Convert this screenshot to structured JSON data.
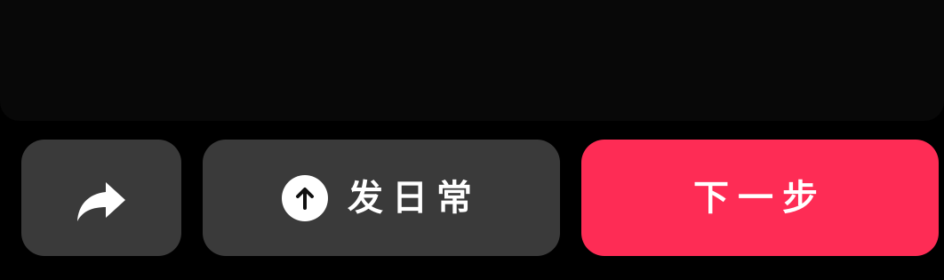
{
  "actions": {
    "share_icon": "share-arrow-icon",
    "daily_icon": "arrow-up-circle-icon",
    "daily_label": "发日常",
    "next_label": "下一步"
  },
  "colors": {
    "background": "#000000",
    "button_dark": "#3a3a3a",
    "accent": "#fe2c55",
    "text": "#ffffff"
  }
}
